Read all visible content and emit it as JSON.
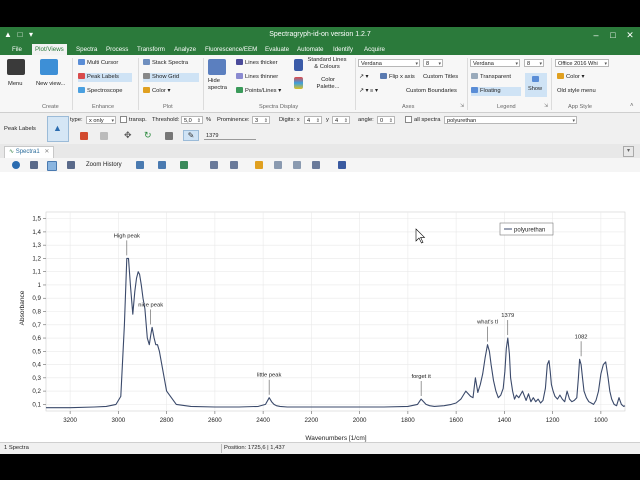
{
  "window": {
    "title": "Spectragryph-id-on version 1.2.7"
  },
  "menubar": [
    {
      "label": "File",
      "active": false
    },
    {
      "label": "Plot/Views",
      "active": true
    },
    {
      "label": "Spectra",
      "active": false
    },
    {
      "label": "Process",
      "active": false
    },
    {
      "label": "Transform",
      "active": false
    },
    {
      "label": "Analyze",
      "active": false
    },
    {
      "label": "Fluorescence/EEM",
      "active": false
    },
    {
      "label": "Evaluate",
      "active": false
    },
    {
      "label": "Automate",
      "active": false
    },
    {
      "label": "Identify",
      "active": false
    },
    {
      "label": "Acquire",
      "active": false
    }
  ],
  "ribbon": {
    "groups": {
      "create": "Create",
      "enhance": "Enhance",
      "plot": "Plot",
      "spectra_display": "Spectra Display",
      "axes": "Axes",
      "legend": "Legend",
      "app_style": "App Style"
    },
    "menu": "Menu",
    "new_view": "New view...",
    "multi_cursor": "Multi Cursor",
    "peak_labels": "Peak Labels",
    "spectroscope": "Spectroscope",
    "stack_spectra": "Stack Spectra",
    "show_grid": "Show Grid",
    "color": "Color",
    "hide_spectra": "Hide spectra",
    "lines_thicker": "Lines thicker",
    "lines_thinner": "Lines thinner",
    "points_lines": "Points/Lines",
    "standard_lines": "Standard Lines & Colours",
    "color_palette": "Color Palette...",
    "axes_font": "Verdana",
    "axes_font_size": "8",
    "flip_x_axis": "Flip x axis",
    "custom_titles": "Custom Titles",
    "custom_boundaries": "Custom Boundaries",
    "legend_font": "Verdana",
    "legend_font_size": "8",
    "transparent": "Transparent",
    "floating": "Floating",
    "show": "Show",
    "app_style": "Office 2016 Whi",
    "app_color": "Color",
    "old_style_menu": "Old style menu"
  },
  "options": {
    "peak_labels": "Peak Labels",
    "type_label": "type:",
    "type_value": "x only",
    "transp": "transp.",
    "threshold_label": "Threshold:",
    "threshold_value": "5,0",
    "threshold_unit": "%",
    "prominence_label": "Prominence:",
    "prominence_value": "3",
    "digits_label": "Digits: x",
    "digits_x": "4",
    "digits_y_label": "y",
    "digits_y": "4",
    "angle_label": "angle:",
    "angle_value": "0",
    "all_spectra": "all spectra",
    "spectrum": "polyurethan",
    "label_input": "1379"
  },
  "document": {
    "tab": "Spectra1"
  },
  "chartbar": {
    "zoom_history": "Zoom History"
  },
  "status": {
    "spectra_count": "1 Spectra",
    "position": "Position: 1725,6 | 1,437"
  },
  "chart_data": {
    "type": "line",
    "title": "",
    "xlabel": "Wavenumbers [1/cm]",
    "ylabel": "Absorbance",
    "xlim": [
      3300,
      900
    ],
    "ylim": [
      0.05,
      1.55
    ],
    "x_ticks": [
      3200,
      3000,
      2800,
      2600,
      2400,
      2200,
      2000,
      1800,
      1600,
      1400,
      1200,
      1000
    ],
    "y_ticks": [
      0.1,
      0.2,
      0.3,
      0.4,
      0.5,
      0.6,
      0.7,
      0.8,
      0.9,
      1.0,
      1.1,
      1.2,
      1.3,
      1.4,
      1.5
    ],
    "y_tick_labels": [
      "0,1",
      "0,2",
      "0,3",
      "0,4",
      "0,5",
      "0,6",
      "0,7",
      "0,8",
      "0,9",
      "1",
      "1,1",
      "1,2",
      "1,3",
      "1,4",
      "1,5"
    ],
    "line_color": "#3b4a6b",
    "legend": {
      "position": "top-right"
    },
    "series": [
      {
        "name": "polyurethan",
        "x": [
          3300,
          3200,
          3100,
          3050,
          3010,
          2990,
          2975,
          2965,
          2958,
          2950,
          2940,
          2932,
          2925,
          2918,
          2912,
          2905,
          2898,
          2890,
          2880,
          2872,
          2866,
          2860,
          2852,
          2845,
          2838,
          2830,
          2820,
          2800,
          2760,
          2700,
          2600,
          2500,
          2420,
          2390,
          2375,
          2365,
          2355,
          2345,
          2330,
          2300,
          2200,
          2100,
          2000,
          1900,
          1800,
          1760,
          1745,
          1735,
          1725,
          1710,
          1690,
          1650,
          1620,
          1600,
          1580,
          1560,
          1540,
          1530,
          1520,
          1510,
          1500,
          1490,
          1480,
          1470,
          1462,
          1455,
          1445,
          1435,
          1425,
          1415,
          1405,
          1398,
          1392,
          1386,
          1379,
          1374,
          1366,
          1358,
          1350,
          1340,
          1325,
          1310,
          1300,
          1290,
          1280,
          1270,
          1260,
          1250,
          1240,
          1230,
          1222,
          1215,
          1210,
          1205,
          1198,
          1190,
          1180,
          1170,
          1160,
          1150,
          1140,
          1130,
          1120,
          1110,
          1100,
          1093,
          1088,
          1082,
          1076,
          1070,
          1060,
          1050,
          1040,
          1030,
          1020,
          1010,
          1000,
          990,
          980,
          970,
          963,
          955,
          945,
          935,
          925,
          915,
          905,
          900
        ],
        "y": [
          0.075,
          0.075,
          0.08,
          0.085,
          0.1,
          0.16,
          0.7,
          1.2,
          1.2,
          1.0,
          0.78,
          0.95,
          1.05,
          1.1,
          1.08,
          1.0,
          0.9,
          0.82,
          0.6,
          0.55,
          0.62,
          0.68,
          0.6,
          0.55,
          0.55,
          0.5,
          0.4,
          0.2,
          0.1,
          0.085,
          0.08,
          0.08,
          0.085,
          0.1,
          0.15,
          0.12,
          0.1,
          0.09,
          0.085,
          0.08,
          0.08,
          0.08,
          0.08,
          0.08,
          0.085,
          0.1,
          0.14,
          0.12,
          0.1,
          0.09,
          0.085,
          0.09,
          0.1,
          0.11,
          0.14,
          0.2,
          0.16,
          0.15,
          0.3,
          0.19,
          0.25,
          0.33,
          0.45,
          0.55,
          0.5,
          0.4,
          0.28,
          0.2,
          0.15,
          0.17,
          0.22,
          0.35,
          0.52,
          0.6,
          0.48,
          0.3,
          0.2,
          0.14,
          0.17,
          0.15,
          0.2,
          0.13,
          0.18,
          0.12,
          0.15,
          0.12,
          0.14,
          0.11,
          0.13,
          0.22,
          0.4,
          0.43,
          0.35,
          0.25,
          0.2,
          0.16,
          0.14,
          0.17,
          0.14,
          0.12,
          0.2,
          0.14,
          0.12,
          0.13,
          0.15,
          0.3,
          0.44,
          0.4,
          0.3,
          0.2,
          0.15,
          0.12,
          0.11,
          0.1,
          0.13,
          0.2,
          0.33,
          0.4,
          0.42,
          0.3,
          0.2,
          0.14,
          0.1,
          0.09,
          0.15,
          0.1,
          0.085,
          0.09
        ]
      }
    ],
    "annotations": [
      {
        "text": "High peak",
        "x": 2965,
        "y": 1.2
      },
      {
        "text": "nice peak",
        "x": 2866,
        "y": 0.68
      },
      {
        "text": "little peak",
        "x": 2375,
        "y": 0.15
      },
      {
        "text": "forget it",
        "x": 1745,
        "y": 0.14
      },
      {
        "text": "what's tl",
        "x": 1470,
        "y": 0.55
      },
      {
        "text": "1379",
        "x": 1386,
        "y": 0.6
      },
      {
        "text": "1082",
        "x": 1082,
        "y": 0.44
      }
    ]
  }
}
